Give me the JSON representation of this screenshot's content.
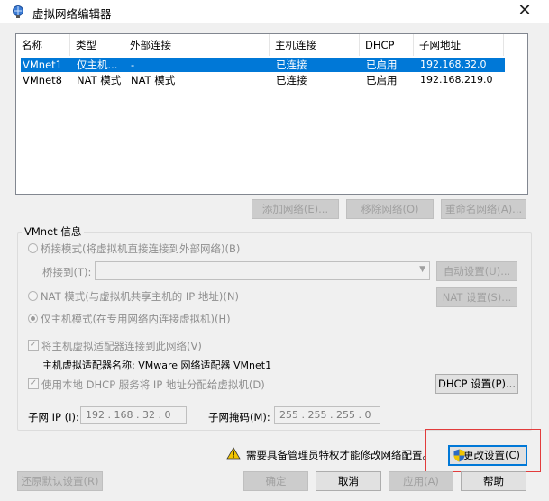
{
  "window": {
    "title": "虚拟网络编辑器",
    "close": "✕"
  },
  "table": {
    "headers": [
      "名称",
      "类型",
      "外部连接",
      "主机连接",
      "DHCP",
      "子网地址"
    ],
    "rows": [
      [
        "VMnet1",
        "仅主机...",
        "-",
        "已连接",
        "已启用",
        "192.168.32.0"
      ],
      [
        "VMnet8",
        "NAT 模式",
        "NAT 模式",
        "已连接",
        "已启用",
        "192.168.219.0"
      ]
    ],
    "selected_row": 0
  },
  "table_buttons": {
    "add": "添加网络(E)...",
    "remove": "移除网络(O)",
    "rename": "重命名网络(A)..."
  },
  "vmnet_info": {
    "label": "VMnet 信息",
    "bridge_mode": "桥接模式(将虚拟机直接连接到外部网络)(B)",
    "bridge_to_label": "桥接到(T):",
    "bridge_to_value": "",
    "auto_settings": "自动设置(U)...",
    "nat_mode": "NAT 模式(与虚拟机共享主机的 IP 地址)(N)",
    "nat_settings": "NAT 设置(S)...",
    "host_only_mode": "仅主机模式(在专用网络内连接虚拟机)(H)",
    "connect_adapter": "将主机虚拟适配器连接到此网络(V)",
    "adapter_name": "主机虚拟适配器名称: VMware 网络适配器 VMnet1",
    "use_dhcp": "使用本地 DHCP 服务将 IP 地址分配给虚拟机(D)",
    "dhcp_settings": "DHCP 设置(P)...",
    "subnet_ip_label": "子网 IP (I):",
    "subnet_ip": "192 . 168 . 32 . 0",
    "subnet_mask_label": "子网掩码(M):",
    "subnet_mask": "255 . 255 . 255 . 0"
  },
  "admin_notice": "需要具备管理员特权才能修改网络配置。",
  "change_settings": "更改设置(C)",
  "bottom_buttons": {
    "restore": "还原默认设置(R)",
    "ok": "确定",
    "cancel": "取消",
    "apply": "应用(A)",
    "help": "帮助"
  },
  "colors": {
    "selection": "#0078d7",
    "highlight_box": "#e23c3c",
    "warning": "#f2c500"
  }
}
